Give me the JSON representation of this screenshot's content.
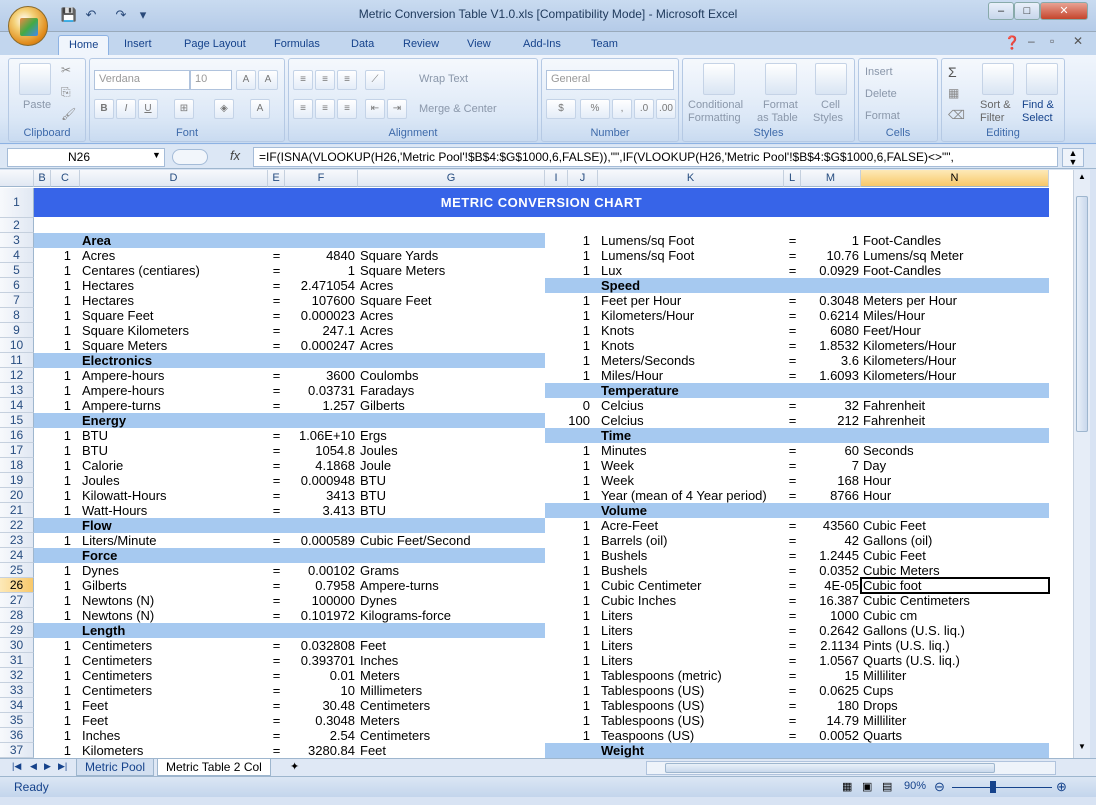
{
  "window": {
    "title": "Metric Conversion Table V1.0.xls  [Compatibility Mode] - Microsoft Excel",
    "minimize": "–",
    "maximize": "□",
    "close": "✕"
  },
  "tabs": [
    "Home",
    "Insert",
    "Page Layout",
    "Formulas",
    "Data",
    "Review",
    "View",
    "Add-Ins",
    "Team"
  ],
  "ribbon": {
    "paste": "Paste",
    "clipboard": "Clipboard",
    "font_name": "Verdana",
    "font_size": "10",
    "font": "Font",
    "wrap": "Wrap Text",
    "merge": "Merge & Center",
    "alignment": "Alignment",
    "number_format": "General",
    "number": "Number",
    "conditional": "Conditional",
    "formatting": "Formatting",
    "format_as": "Format",
    "as_table": "as Table",
    "cell": "Cell",
    "styles_l": "Styles",
    "styles": "Styles",
    "insert": "Insert",
    "delete": "Delete",
    "format": "Format",
    "cells": "Cells",
    "sort": "Sort &",
    "filter": "Filter",
    "find": "Find &",
    "select": "Select",
    "editing": "Editing"
  },
  "formula_bar": {
    "name_box": "N26",
    "fx": "fx",
    "formula": "=IF(ISNA(VLOOKUP(H26,'Metric Pool'!$B$4:$G$1000,6,FALSE)),\"\",IF(VLOOKUP(H26,'Metric Pool'!$B$4:$G$1000,6,FALSE)<>\"\","
  },
  "columns": [
    "B",
    "C",
    "D",
    "E",
    "F",
    "G",
    "I",
    "J",
    "K",
    "L",
    "M",
    "N"
  ],
  "chart_title": "METRIC CONVERSION CHART",
  "left_rows": [
    {
      "row": "3",
      "section": "Area"
    },
    {
      "row": "4",
      "n": "1",
      "unit": "Acres",
      "eq": "=",
      "val": "4840",
      "to": "Square Yards"
    },
    {
      "row": "5",
      "n": "1",
      "unit": "Centares (centiares)",
      "eq": "=",
      "val": "1",
      "to": "Square Meters"
    },
    {
      "row": "6",
      "n": "1",
      "unit": "Hectares",
      "eq": "=",
      "val": "2.471054",
      "to": "Acres"
    },
    {
      "row": "7",
      "n": "1",
      "unit": "Hectares",
      "eq": "=",
      "val": "107600",
      "to": "Square Feet"
    },
    {
      "row": "8",
      "n": "1",
      "unit": "Square Feet",
      "eq": "=",
      "val": "0.000023",
      "to": "Acres"
    },
    {
      "row": "9",
      "n": "1",
      "unit": "Square Kilometers",
      "eq": "=",
      "val": "247.1",
      "to": "Acres"
    },
    {
      "row": "10",
      "n": "1",
      "unit": "Square Meters",
      "eq": "=",
      "val": "0.000247",
      "to": "Acres"
    },
    {
      "row": "11",
      "section": "Electronics"
    },
    {
      "row": "12",
      "n": "1",
      "unit": "Ampere-hours",
      "eq": "=",
      "val": "3600",
      "to": "Coulombs"
    },
    {
      "row": "13",
      "n": "1",
      "unit": "Ampere-hours",
      "eq": "=",
      "val": "0.03731",
      "to": "Faradays"
    },
    {
      "row": "14",
      "n": "1",
      "unit": "Ampere-turns",
      "eq": "=",
      "val": "1.257",
      "to": "Gilberts"
    },
    {
      "row": "15",
      "section": "Energy"
    },
    {
      "row": "16",
      "n": "1",
      "unit": "BTU",
      "eq": "=",
      "val": "1.06E+10",
      "to": "Ergs"
    },
    {
      "row": "17",
      "n": "1",
      "unit": "BTU",
      "eq": "=",
      "val": "1054.8",
      "to": "Joules"
    },
    {
      "row": "18",
      "n": "1",
      "unit": "Calorie",
      "eq": "=",
      "val": "4.1868",
      "to": "Joule"
    },
    {
      "row": "19",
      "n": "1",
      "unit": "Joules",
      "eq": "=",
      "val": "0.000948",
      "to": "BTU"
    },
    {
      "row": "20",
      "n": "1",
      "unit": "Kilowatt-Hours",
      "eq": "=",
      "val": "3413",
      "to": "BTU"
    },
    {
      "row": "21",
      "n": "1",
      "unit": "Watt-Hours",
      "eq": "=",
      "val": "3.413",
      "to": "BTU"
    },
    {
      "row": "22",
      "section": "Flow"
    },
    {
      "row": "23",
      "n": "1",
      "unit": "Liters/Minute",
      "eq": "=",
      "val": "0.000589",
      "to": "Cubic Feet/Second"
    },
    {
      "row": "24",
      "section": "Force"
    },
    {
      "row": "25",
      "n": "1",
      "unit": "Dynes",
      "eq": "=",
      "val": "0.00102",
      "to": "Grams"
    },
    {
      "row": "26",
      "n": "1",
      "unit": "Gilberts",
      "eq": "=",
      "val": "0.7958",
      "to": "Ampere-turns"
    },
    {
      "row": "27",
      "n": "1",
      "unit": "Newtons (N)",
      "eq": "=",
      "val": "100000",
      "to": "Dynes"
    },
    {
      "row": "28",
      "n": "1",
      "unit": "Newtons (N)",
      "eq": "=",
      "val": "0.101972",
      "to": "Kilograms-force"
    },
    {
      "row": "29",
      "section": "Length"
    },
    {
      "row": "30",
      "n": "1",
      "unit": "Centimeters",
      "eq": "=",
      "val": "0.032808",
      "to": "Feet"
    },
    {
      "row": "31",
      "n": "1",
      "unit": "Centimeters",
      "eq": "=",
      "val": "0.393701",
      "to": "Inches"
    },
    {
      "row": "32",
      "n": "1",
      "unit": "Centimeters",
      "eq": "=",
      "val": "0.01",
      "to": "Meters"
    },
    {
      "row": "33",
      "n": "1",
      "unit": "Centimeters",
      "eq": "=",
      "val": "10",
      "to": "Millimeters"
    },
    {
      "row": "34",
      "n": "1",
      "unit": "Feet",
      "eq": "=",
      "val": "30.48",
      "to": "Centimeters"
    },
    {
      "row": "35",
      "n": "1",
      "unit": "Feet",
      "eq": "=",
      "val": "0.3048",
      "to": "Meters"
    },
    {
      "row": "36",
      "n": "1",
      "unit": "Inches",
      "eq": "=",
      "val": "2.54",
      "to": "Centimeters"
    },
    {
      "row": "37",
      "n": "1",
      "unit": "Kilometers",
      "eq": "=",
      "val": "3280.84",
      "to": "Feet"
    }
  ],
  "right_rows": [
    {
      "n": "1",
      "unit": "Lumens/sq Foot",
      "eq": "=",
      "val": "1",
      "to": "Foot-Candles"
    },
    {
      "n": "1",
      "unit": "Lumens/sq Foot",
      "eq": "=",
      "val": "10.76",
      "to": "Lumens/sq Meter"
    },
    {
      "n": "1",
      "unit": "Lux",
      "eq": "=",
      "val": "0.0929",
      "to": "Foot-Candles"
    },
    {
      "section": "Speed"
    },
    {
      "n": "1",
      "unit": "Feet per Hour",
      "eq": "=",
      "val": "0.3048",
      "to": "Meters per Hour"
    },
    {
      "n": "1",
      "unit": "Kilometers/Hour",
      "eq": "=",
      "val": "0.6214",
      "to": "Miles/Hour"
    },
    {
      "n": "1",
      "unit": "Knots",
      "eq": "=",
      "val": "6080",
      "to": "Feet/Hour"
    },
    {
      "n": "1",
      "unit": "Knots",
      "eq": "=",
      "val": "1.8532",
      "to": "Kilometers/Hour"
    },
    {
      "n": "1",
      "unit": "Meters/Seconds",
      "eq": "=",
      "val": "3.6",
      "to": "Kilometers/Hour"
    },
    {
      "n": "1",
      "unit": "Miles/Hour",
      "eq": "=",
      "val": "1.6093",
      "to": "Kilometers/Hour"
    },
    {
      "section": "Temperature"
    },
    {
      "n": "0",
      "unit": "Celcius",
      "eq": "=",
      "val": "32",
      "to": "Fahrenheit"
    },
    {
      "n": "100",
      "unit": "Celcius",
      "eq": "=",
      "val": "212",
      "to": "Fahrenheit"
    },
    {
      "section": "Time"
    },
    {
      "n": "1",
      "unit": "Minutes",
      "eq": "=",
      "val": "60",
      "to": "Seconds"
    },
    {
      "n": "1",
      "unit": "Week",
      "eq": "=",
      "val": "7",
      "to": "Day"
    },
    {
      "n": "1",
      "unit": "Week",
      "eq": "=",
      "val": "168",
      "to": "Hour"
    },
    {
      "n": "1",
      "unit": "Year (mean of 4 Year period)",
      "eq": "=",
      "val": "8766",
      "to": "Hour"
    },
    {
      "section": "Volume"
    },
    {
      "n": "1",
      "unit": "Acre-Feet",
      "eq": "=",
      "val": "43560",
      "to": "Cubic Feet"
    },
    {
      "n": "1",
      "unit": "Barrels (oil)",
      "eq": "=",
      "val": "42",
      "to": "Gallons (oil)"
    },
    {
      "n": "1",
      "unit": "Bushels",
      "eq": "=",
      "val": "1.2445",
      "to": "Cubic Feet"
    },
    {
      "n": "1",
      "unit": "Bushels",
      "eq": "=",
      "val": "0.0352",
      "to": "Cubic Meters"
    },
    {
      "n": "1",
      "unit": "Cubic Centimeter",
      "eq": "=",
      "val": "4E-05",
      "to": "Cubic foot"
    },
    {
      "n": "1",
      "unit": "Cubic Inches",
      "eq": "=",
      "val": "16.387",
      "to": "Cubic Centimeters"
    },
    {
      "n": "1",
      "unit": "Liters",
      "eq": "=",
      "val": "1000",
      "to": "Cubic cm"
    },
    {
      "n": "1",
      "unit": "Liters",
      "eq": "=",
      "val": "0.2642",
      "to": "Gallons (U.S. liq.)"
    },
    {
      "n": "1",
      "unit": "Liters",
      "eq": "=",
      "val": "2.1134",
      "to": "Pints (U.S. liq.)"
    },
    {
      "n": "1",
      "unit": "Liters",
      "eq": "=",
      "val": "1.0567",
      "to": "Quarts (U.S. liq.)"
    },
    {
      "n": "1",
      "unit": "Tablespoons (metric)",
      "eq": "=",
      "val": "15",
      "to": "Milliliter"
    },
    {
      "n": "1",
      "unit": "Tablespoons (US)",
      "eq": "=",
      "val": "0.0625",
      "to": "Cups"
    },
    {
      "n": "1",
      "unit": "Tablespoons (US)",
      "eq": "=",
      "val": "180",
      "to": "Drops"
    },
    {
      "n": "1",
      "unit": "Tablespoons (US)",
      "eq": "=",
      "val": "14.79",
      "to": "Milliliter"
    },
    {
      "n": "1",
      "unit": "Teaspoons (US)",
      "eq": "=",
      "val": "0.0052",
      "to": "Quarts"
    },
    {
      "section": "Weight"
    }
  ],
  "row1": "1",
  "row2": "2",
  "sheets": [
    "Metric Pool",
    "Metric Table 2 Col"
  ],
  "status": {
    "ready": "Ready",
    "zoom": "90%"
  },
  "colors": {
    "header_band": "#3764e8",
    "section_band": "#a6c9f0"
  }
}
